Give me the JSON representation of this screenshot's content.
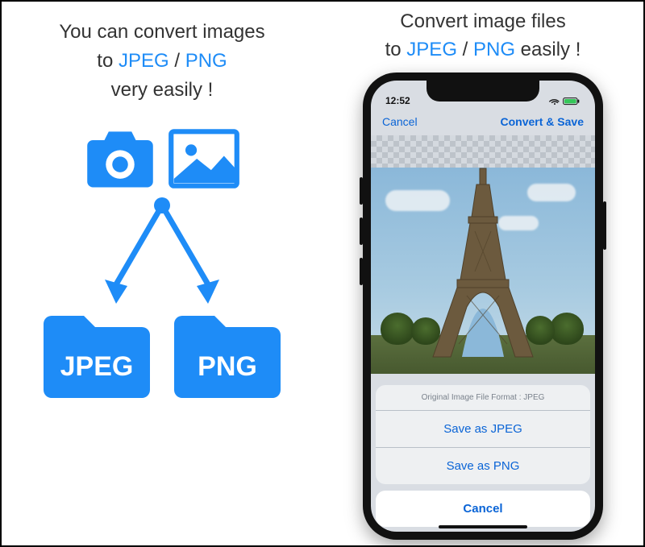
{
  "left": {
    "line1": "You can convert images",
    "line2_prefix": "to ",
    "format_jpeg": "JPEG",
    "sep": " / ",
    "format_png": "PNG",
    "line3": "very easily !",
    "folder_jpeg_label": "JPEG",
    "folder_png_label": "PNG"
  },
  "right": {
    "line1": "Convert image files",
    "line2_prefix": "to ",
    "format_jpeg": "JPEG",
    "sep": " / ",
    "format_png": "PNG",
    "line2_suffix": " easily !"
  },
  "phone": {
    "time": "12:52",
    "nav_cancel": "Cancel",
    "nav_action": "Convert & Save",
    "sheet_header": "Original Image File Format : JPEG",
    "sheet_save_jpeg": "Save as JPEG",
    "sheet_save_png": "Save as PNG",
    "sheet_cancel": "Cancel"
  },
  "colors": {
    "accent": "#1E8CF7",
    "ios_link": "#0A64D6"
  }
}
